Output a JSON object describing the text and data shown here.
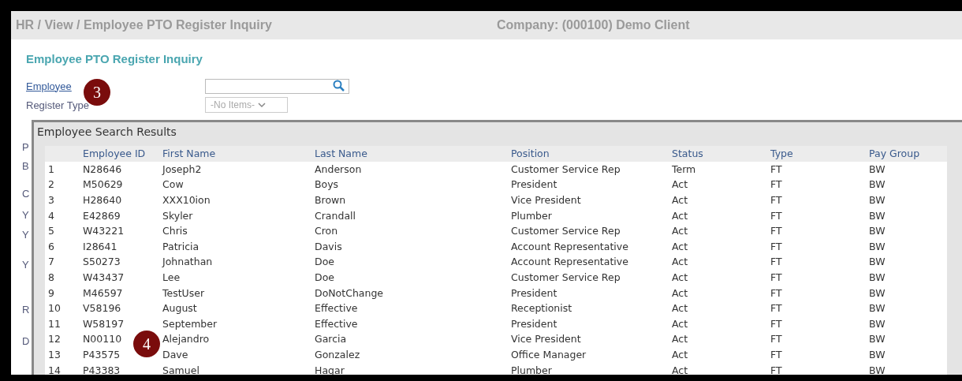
{
  "header": {
    "breadcrumb": "HR / View / Employee PTO Register Inquiry",
    "company": "Company: (000100) Demo Client"
  },
  "page_title": "Employee PTO Register Inquiry",
  "form": {
    "employee_label": "Employee",
    "register_type_label": "Register Type",
    "register_type_value": "-No Items-",
    "hidden_labels": [
      "P",
      "B",
      "C",
      "Y",
      "Y",
      "Y",
      "R",
      "D"
    ]
  },
  "callouts": [
    "3",
    "4"
  ],
  "dialog": {
    "title": "Employee Search Results",
    "columns": [
      "",
      "Employee ID",
      "First Name",
      "Last Name",
      "Position",
      "Status",
      "Type",
      "Pay Group"
    ],
    "rows": [
      [
        "1",
        "N28646",
        "Joseph2",
        "Anderson",
        "Customer Service Rep",
        "Term",
        "FT",
        "BW"
      ],
      [
        "2",
        "M50629",
        "Cow",
        "Boys",
        "President",
        "Act",
        "FT",
        "BW"
      ],
      [
        "3",
        "H28640",
        "XXX10ion",
        "Brown",
        "Vice President",
        "Act",
        "FT",
        "BW"
      ],
      [
        "4",
        "E42869",
        "Skyler",
        "Crandall",
        "Plumber",
        "Act",
        "FT",
        "BW"
      ],
      [
        "5",
        "W43221",
        "Chris",
        "Cron",
        "Customer Service Rep",
        "Act",
        "FT",
        "BW"
      ],
      [
        "6",
        "I28641",
        "Patricia",
        "Davis",
        "Account Representative",
        "Act",
        "FT",
        "BW"
      ],
      [
        "7",
        "S50273",
        "Johnathan",
        "Doe",
        "Account Representative",
        "Act",
        "FT",
        "BW"
      ],
      [
        "8",
        "W43437",
        "Lee",
        "Doe",
        "Customer Service Rep",
        "Act",
        "FT",
        "BW"
      ],
      [
        "9",
        "M46597",
        "TestUser",
        "DoNotChange",
        "President",
        "Act",
        "FT",
        "BW"
      ],
      [
        "10",
        "V58196",
        "August",
        "Effective",
        "Receptionist",
        "Act",
        "FT",
        "BW"
      ],
      [
        "11",
        "W58197",
        "September",
        "Effective",
        "President",
        "Act",
        "FT",
        "BW"
      ],
      [
        "12",
        "N00110",
        "Alejandro",
        "Garcia",
        "Vice President",
        "Act",
        "FT",
        "BW"
      ],
      [
        "13",
        "P43575",
        "Dave",
        "Gonzalez",
        "Office Manager",
        "Act",
        "FT",
        "BW"
      ],
      [
        "14",
        "P43383",
        "Samuel",
        "Hagar",
        "Plumber",
        "Act",
        "FT",
        "BW"
      ]
    ]
  }
}
